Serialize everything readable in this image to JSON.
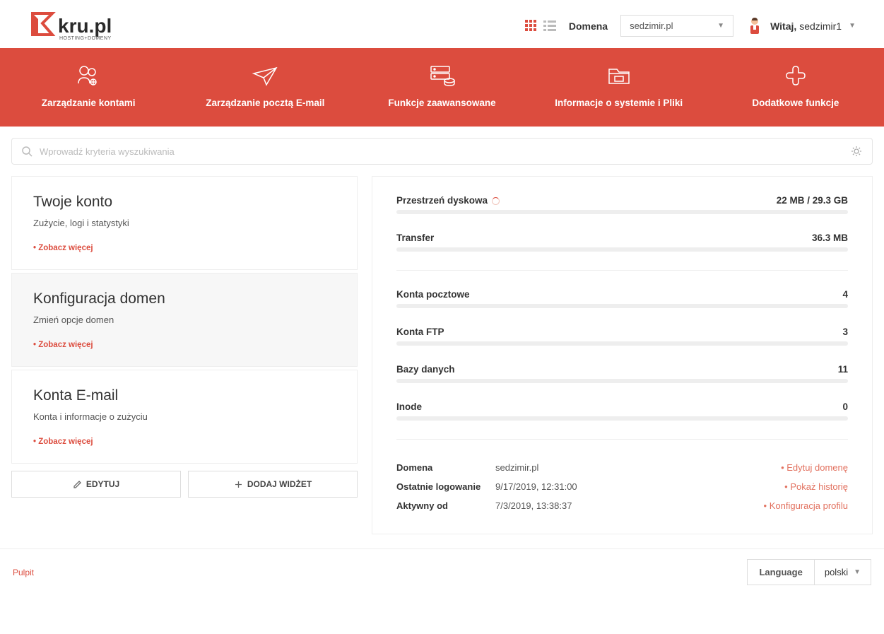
{
  "logo": {
    "text": "kru.pl",
    "sub": "HOSTING+DOMENY"
  },
  "header": {
    "domain_label": "Domena",
    "domain_value": "sedzimir.pl",
    "welcome_prefix": "Witaj, ",
    "username": "sedzimir1"
  },
  "nav": [
    {
      "label": "Zarządzanie kontami"
    },
    {
      "label": "Zarządzanie pocztą E-mail"
    },
    {
      "label": "Funkcje zaawansowane"
    },
    {
      "label": "Informacje o systemie i Pliki"
    },
    {
      "label": "Dodatkowe funkcje"
    }
  ],
  "search": {
    "placeholder": "Wprowadź kryteria wyszukiwania"
  },
  "cards": [
    {
      "title": "Twoje konto",
      "desc": "Zużycie, logi i statystyki",
      "more": "Zobacz więcej"
    },
    {
      "title": "Konfiguracja domen",
      "desc": "Zmień opcje domen",
      "more": "Zobacz więcej"
    },
    {
      "title": "Konta E-mail",
      "desc": "Konta i informacje o zużyciu",
      "more": "Zobacz więcej"
    }
  ],
  "buttons": {
    "edit": "EDYTUJ",
    "add_widget": "DODAJ WIDŻET"
  },
  "stats": [
    {
      "label": "Przestrzeń dyskowa",
      "value": "22 MB / 29.3 GB",
      "spinner": true
    },
    {
      "label": "Transfer",
      "value": "36.3 MB"
    },
    {
      "label": "Konta pocztowe",
      "value": "4"
    },
    {
      "label": "Konta FTP",
      "value": "3"
    },
    {
      "label": "Bazy danych",
      "value": "11"
    },
    {
      "label": "Inode",
      "value": "0"
    }
  ],
  "info": {
    "rows": [
      {
        "label": "Domena",
        "value": "sedzimir.pl",
        "link": "Edytuj domenę"
      },
      {
        "label": "Ostatnie logowanie",
        "value": "9/17/2019, 12:31:00",
        "link": "Pokaż historię"
      },
      {
        "label": "Aktywny od",
        "value": "7/3/2019, 13:38:37",
        "link": "Konfiguracja profilu"
      }
    ]
  },
  "footer": {
    "breadcrumb": "Pulpit",
    "lang_label": "Language",
    "lang_value": "polski"
  }
}
